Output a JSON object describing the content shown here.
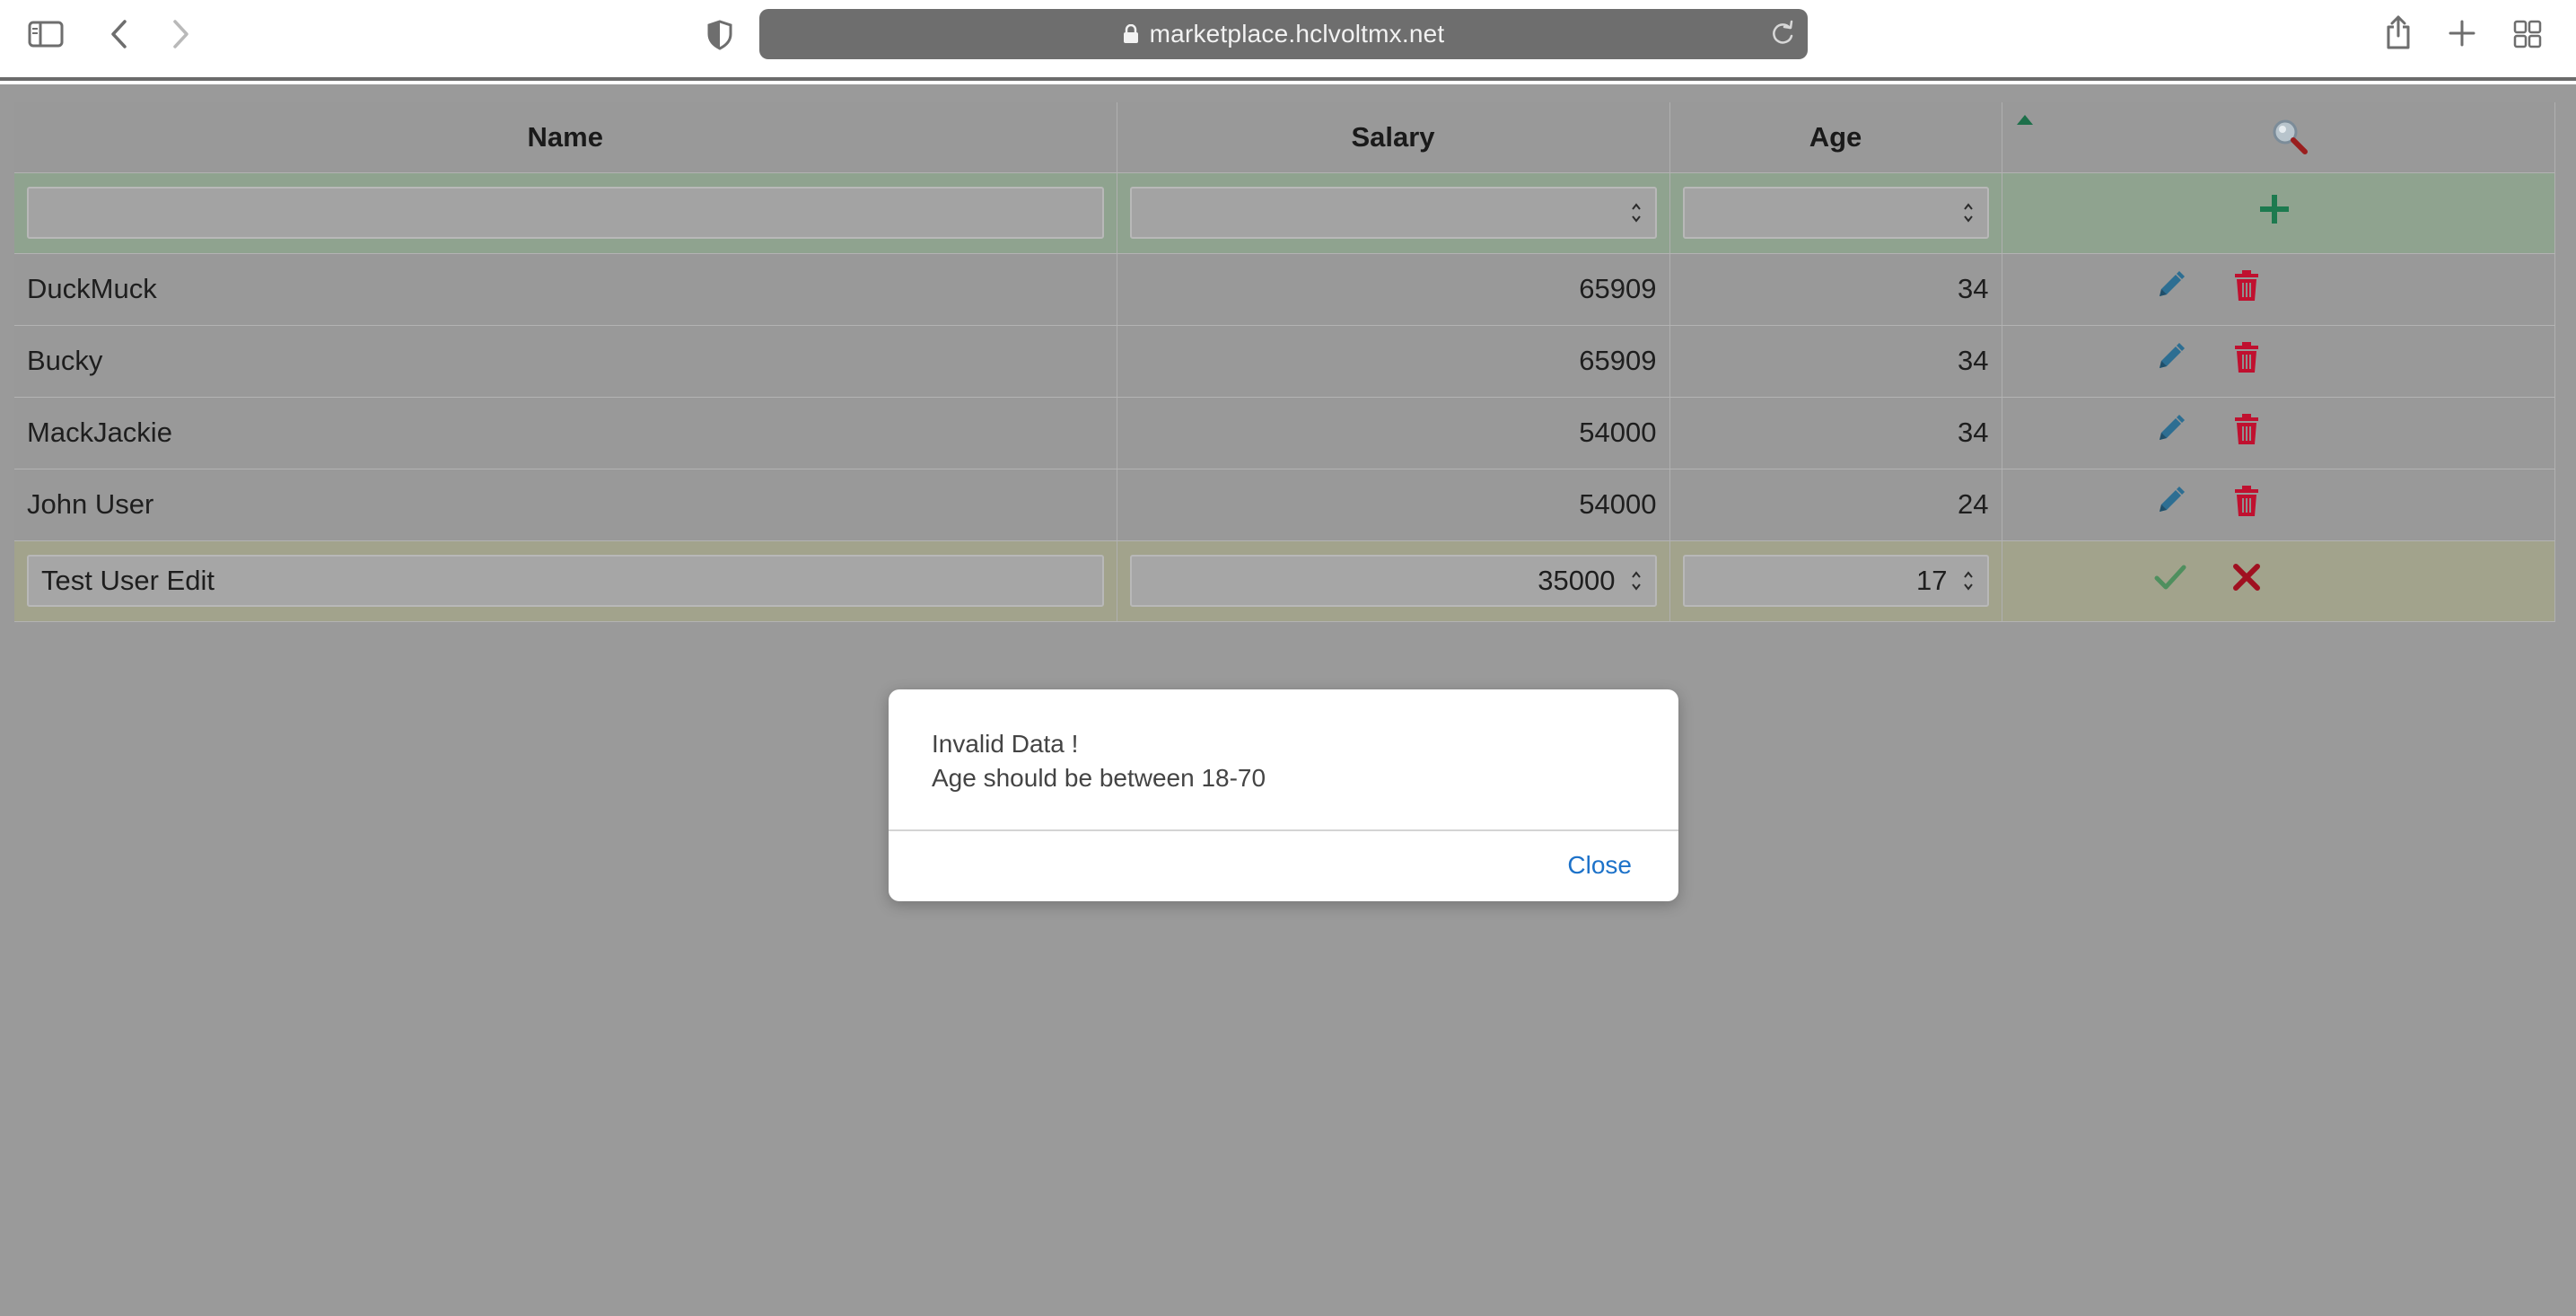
{
  "browser": {
    "url": "marketplace.hclvoltmx.net"
  },
  "grid": {
    "columns": [
      {
        "label": "Name"
      },
      {
        "label": "Salary"
      },
      {
        "label": "Age"
      }
    ],
    "new_row": {
      "name_value": "",
      "salary_value": "",
      "age_value": ""
    },
    "rows": [
      {
        "name": "DuckMuck",
        "salary": "65909",
        "age": "34"
      },
      {
        "name": "Bucky",
        "salary": "65909",
        "age": "34"
      },
      {
        "name": "MackJackie",
        "salary": "54000",
        "age": "34"
      },
      {
        "name": "John User",
        "salary": "54000",
        "age": "24"
      }
    ],
    "edit_row": {
      "name_value": "Test User Edit",
      "salary_value": "35000",
      "age_value": "17"
    }
  },
  "dialog": {
    "line1": "Invalid Data !",
    "line2": "Age should be between 18-70",
    "close_label": "Close"
  },
  "colors": {
    "accent_green": "#1d7a4f",
    "edit_blue": "#2d6e92",
    "delete_red": "#c0102f",
    "link_blue": "#1d72c9"
  },
  "icons": {
    "sidebar": "sidebar-icon",
    "back": "chevron-left-icon",
    "forward": "chevron-right-icon",
    "privacy": "shield-icon",
    "lock": "lock-icon",
    "reload": "reload-icon",
    "share": "share-icon",
    "new_tab": "plus-icon",
    "tabs": "tab-grid-icon",
    "search": "search-icon",
    "add": "plus-icon",
    "edit": "pencil-icon",
    "delete": "trash-icon",
    "confirm": "check-icon",
    "cancel": "x-icon"
  }
}
